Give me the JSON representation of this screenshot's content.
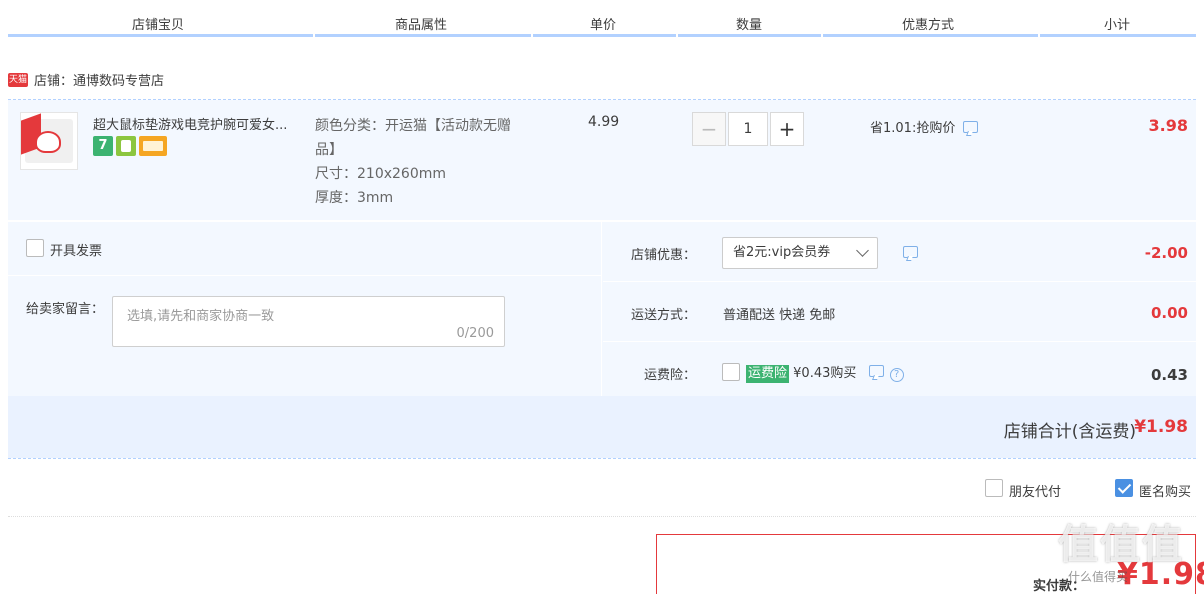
{
  "header": {
    "columns": [
      "店铺宝贝",
      "商品属性",
      "单价",
      "数量",
      "优惠方式",
      "小计"
    ]
  },
  "shop": {
    "badge": "天猫",
    "name_label": "店铺：通博数码专营店"
  },
  "item": {
    "title": "超大鼠标垫游戏电竞护腕可爱女...",
    "badge_7": "7",
    "props": [
      "颜色分类：开运猫【活动款无赠品】",
      "尺寸：210x260mm",
      "厚度：3mm"
    ],
    "unit_price": "4.99",
    "quantity": "1",
    "qty_minus": "−",
    "qty_plus": "+",
    "promo": "省1.01:抢购价",
    "subtotal": "3.98"
  },
  "invoice": {
    "label": "开具发票"
  },
  "message": {
    "label": "给卖家留言：",
    "placeholder": "选填,请先和商家协商一致",
    "counter": "0/200"
  },
  "shop_discount": {
    "label": "店铺优惠：",
    "selected": "省2元:vip会员券",
    "amount": "-2.00"
  },
  "shipping": {
    "label": "运送方式：",
    "value": "普通配送 快递 免邮",
    "amount": "0.00"
  },
  "insurance": {
    "label": "运费险：",
    "tag": "运费险",
    "text": "¥0.43购买",
    "help": "?",
    "amount": "0.43"
  },
  "shop_total": {
    "label": "店铺合计(含运费)",
    "value": "¥1.98"
  },
  "options": {
    "friend_pay": "朋友代付",
    "anonymous": "匿名购买"
  },
  "pay": {
    "label": "实付款：",
    "value": "¥1.98"
  },
  "watermark": {
    "big": "值值值",
    "small": "什么值得买"
  },
  "colors": {
    "accent_red": "#e4393c",
    "header_line": "#b2d1ff",
    "panel_bg": "#f3f8ff"
  }
}
